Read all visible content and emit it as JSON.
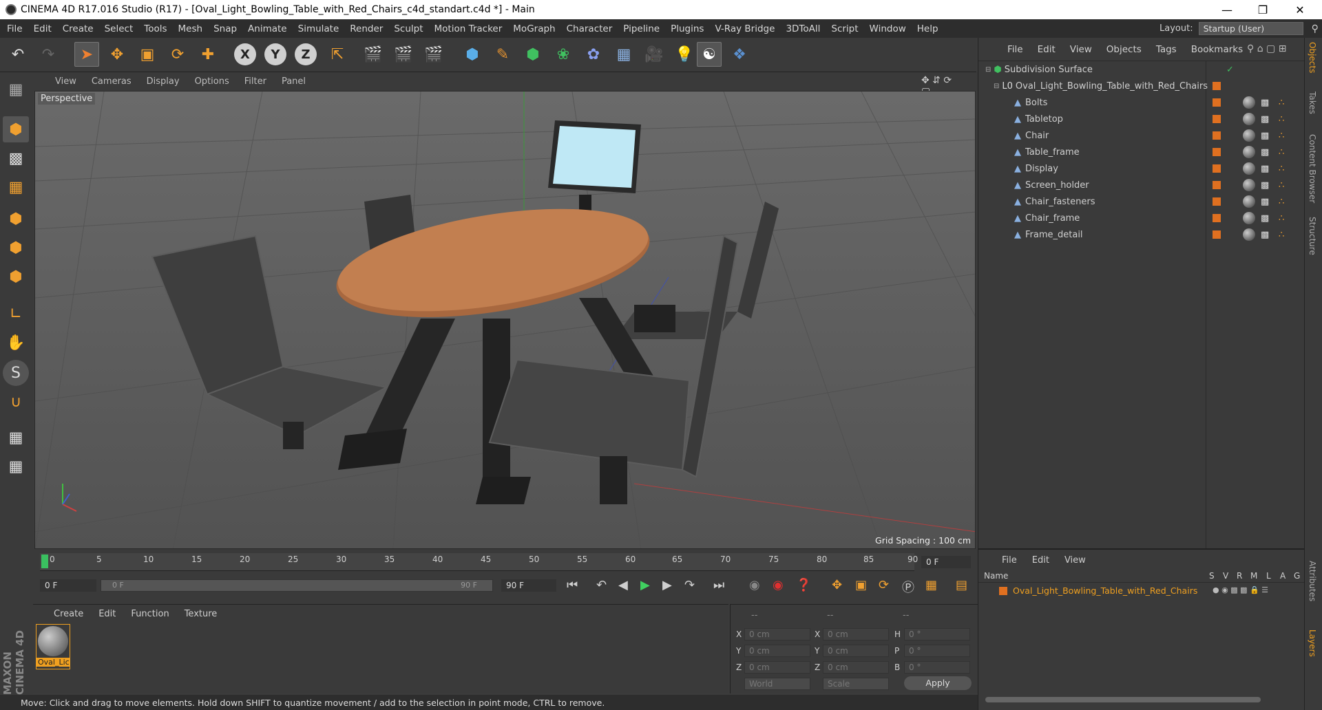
{
  "window": {
    "title": "CINEMA 4D R17.016 Studio (R17) - [Oval_Light_Bowling_Table_with_Red_Chairs_c4d_standart.c4d *] - Main"
  },
  "menubar": {
    "items": [
      "File",
      "Edit",
      "Create",
      "Select",
      "Tools",
      "Mesh",
      "Snap",
      "Animate",
      "Simulate",
      "Render",
      "Sculpt",
      "Motion Tracker",
      "MoGraph",
      "Character",
      "Pipeline",
      "Plugins",
      "V-Ray Bridge",
      "3DToAll",
      "Script",
      "Window",
      "Help"
    ]
  },
  "layout": {
    "label": "Layout:",
    "value": "Startup (User)"
  },
  "viewport": {
    "menu": [
      "View",
      "Cameras",
      "Display",
      "Options",
      "Filter",
      "Panel"
    ],
    "label": "Perspective",
    "grid_spacing": "Grid Spacing : 100 cm"
  },
  "objects": {
    "menu": [
      "File",
      "Edit",
      "View",
      "Objects",
      "Tags",
      "Bookmarks"
    ],
    "root": "Subdivision Surface",
    "group": "Oval_Light_Bowling_Table_with_Red_Chairs",
    "children": [
      "Bolts",
      "Tabletop",
      "Chair",
      "Table_frame",
      "Display",
      "Screen_holder",
      "Chair_fasteners",
      "Chair_frame",
      "Frame_detail"
    ]
  },
  "timeline": {
    "ticks": [
      "0",
      "5",
      "10",
      "15",
      "20",
      "25",
      "30",
      "35",
      "40",
      "45",
      "50",
      "55",
      "60",
      "65",
      "70",
      "75",
      "80",
      "85",
      "90"
    ],
    "current_frame": "0 F",
    "start_field": "0 F",
    "slider_start": "0 F",
    "slider_end": "90 F",
    "end_field": "90 F"
  },
  "materials": {
    "menu": [
      "Create",
      "Edit",
      "Function",
      "Texture"
    ],
    "item_label": "Oval_Lic"
  },
  "coords": {
    "headers": [
      "--",
      "--",
      "--"
    ],
    "rows": [
      {
        "a": "X",
        "av": "0 cm",
        "b": "X",
        "bv": "0 cm",
        "c": "H",
        "cv": "0 °"
      },
      {
        "a": "Y",
        "av": "0 cm",
        "b": "Y",
        "bv": "0 cm",
        "c": "P",
        "cv": "0 °"
      },
      {
        "a": "Z",
        "av": "0 cm",
        "b": "Z",
        "bv": "0 cm",
        "c": "B",
        "cv": "0 °"
      }
    ],
    "world": "World",
    "scale": "Scale",
    "apply": "Apply"
  },
  "layers": {
    "menu": [
      "File",
      "Edit",
      "View"
    ],
    "col_name": "Name",
    "cols": [
      "S",
      "V",
      "R",
      "M",
      "L",
      "A",
      "G"
    ],
    "row": "Oval_Light_Bowling_Table_with_Red_Chairs"
  },
  "status": {
    "text": "Move: Click and drag to move elements. Hold down SHIFT to quantize movement / add to the selection in point mode, CTRL to remove."
  },
  "sidetabs": {
    "right": [
      "Objects",
      "Takes",
      "Content Browser",
      "Structure",
      "Attributes",
      "Layers"
    ]
  },
  "branding": {
    "logo": "MAXON CINEMA 4D"
  },
  "colors": {
    "accent": "#e07020",
    "selection": "#f0a020"
  }
}
